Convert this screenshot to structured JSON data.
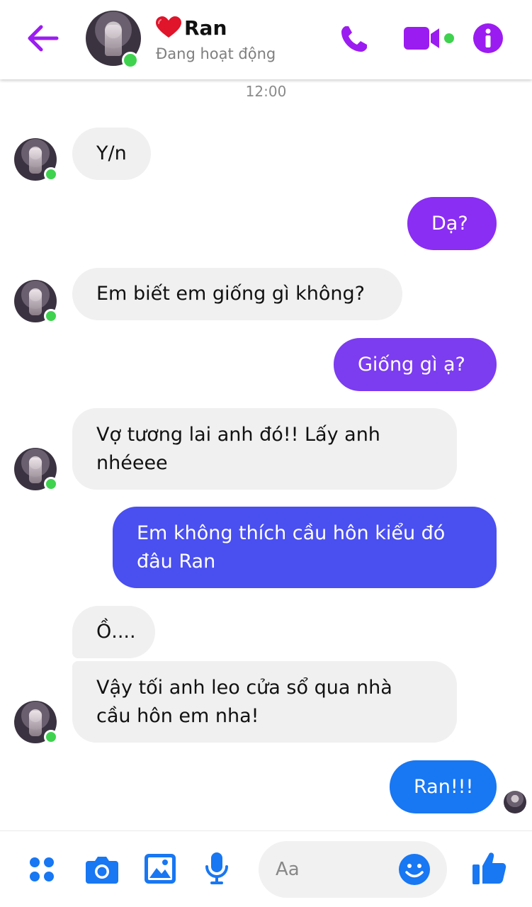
{
  "header": {
    "contact_name": "Ran",
    "status": "Đang hoạt động",
    "icons": [
      "back-arrow-icon",
      "heart-icon",
      "phone-icon",
      "video-camera-icon",
      "info-icon"
    ]
  },
  "timestamp": "12:00",
  "messages": [
    {
      "side": "in",
      "text": "Y/n"
    },
    {
      "side": "out",
      "text": "Dạ?"
    },
    {
      "side": "in",
      "text": "Em biết em giống gì không?"
    },
    {
      "side": "out",
      "text": "Giống gì ạ?"
    },
    {
      "side": "in",
      "text": "Vợ tương lai anh đó!! Lấy anh\nnhéeee"
    },
    {
      "side": "out",
      "text": "Em không thích cầu hôn kiểu đó\nđâu Ran"
    },
    {
      "side": "in",
      "text": "Ồ...."
    },
    {
      "side": "in",
      "text": "Vậy tối anh leo cửa sổ qua nhà\ncầu hôn em nha!"
    },
    {
      "side": "out",
      "text": "Ran!!!"
    }
  ],
  "composer": {
    "placeholder": "Aa",
    "icons": [
      "menu-dots-icon",
      "camera-icon",
      "image-icon",
      "microphone-icon",
      "emoji-icon",
      "thumbs-up-icon"
    ]
  },
  "colors": {
    "accent_purple": "#9b1cf0",
    "bubble_purple": "#8a2ef3",
    "bubble_violet": "#7c3cf0",
    "bubble_indigo": "#4a4ff0",
    "bubble_blue": "#1877f2",
    "incoming_bubble": "#f0f0f0",
    "online_green": "#3fd24f"
  }
}
